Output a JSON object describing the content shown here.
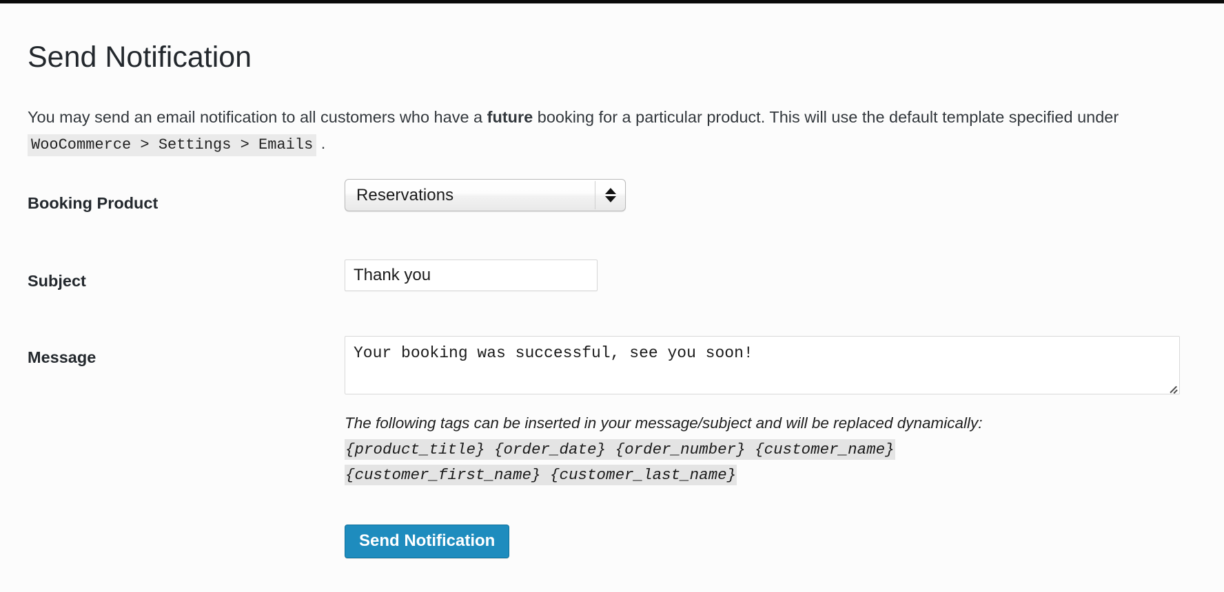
{
  "page": {
    "title": "Send Notification"
  },
  "intro": {
    "part1": "You may send an email notification to all customers who have a ",
    "emphasis": "future",
    "part2": " booking for a particular product. This will use the default template specified under ",
    "code_path": "WooCommerce > Settings > Emails",
    "part3": " ."
  },
  "form": {
    "product": {
      "label": "Booking Product",
      "selected_option": "Reservations",
      "options": [
        "Reservations"
      ]
    },
    "subject": {
      "label": "Subject",
      "value": "Thank you",
      "placeholder": ""
    },
    "message": {
      "label": "Message",
      "value": "Your booking was successful, see you soon!",
      "placeholder": ""
    }
  },
  "tags_help": {
    "lead": "The following tags can be inserted in your message/subject and will be replaced dynamically:",
    "line1": " {product_title} {order_date} {order_number} {customer_name}",
    "line2": "{customer_first_name} {customer_last_name}",
    "tags": [
      "{product_title}",
      "{order_date}",
      "{order_number}",
      "{customer_name}",
      "{customer_first_name}",
      "{customer_last_name}"
    ]
  },
  "actions": {
    "submit_label": "Send Notification"
  },
  "colors": {
    "button_primary": "#1e8cbe",
    "button_primary_border": "#0e719c",
    "page_background": "#fcfcfc",
    "code_background": "#e4e4e4",
    "heading_text": "#23282d"
  }
}
